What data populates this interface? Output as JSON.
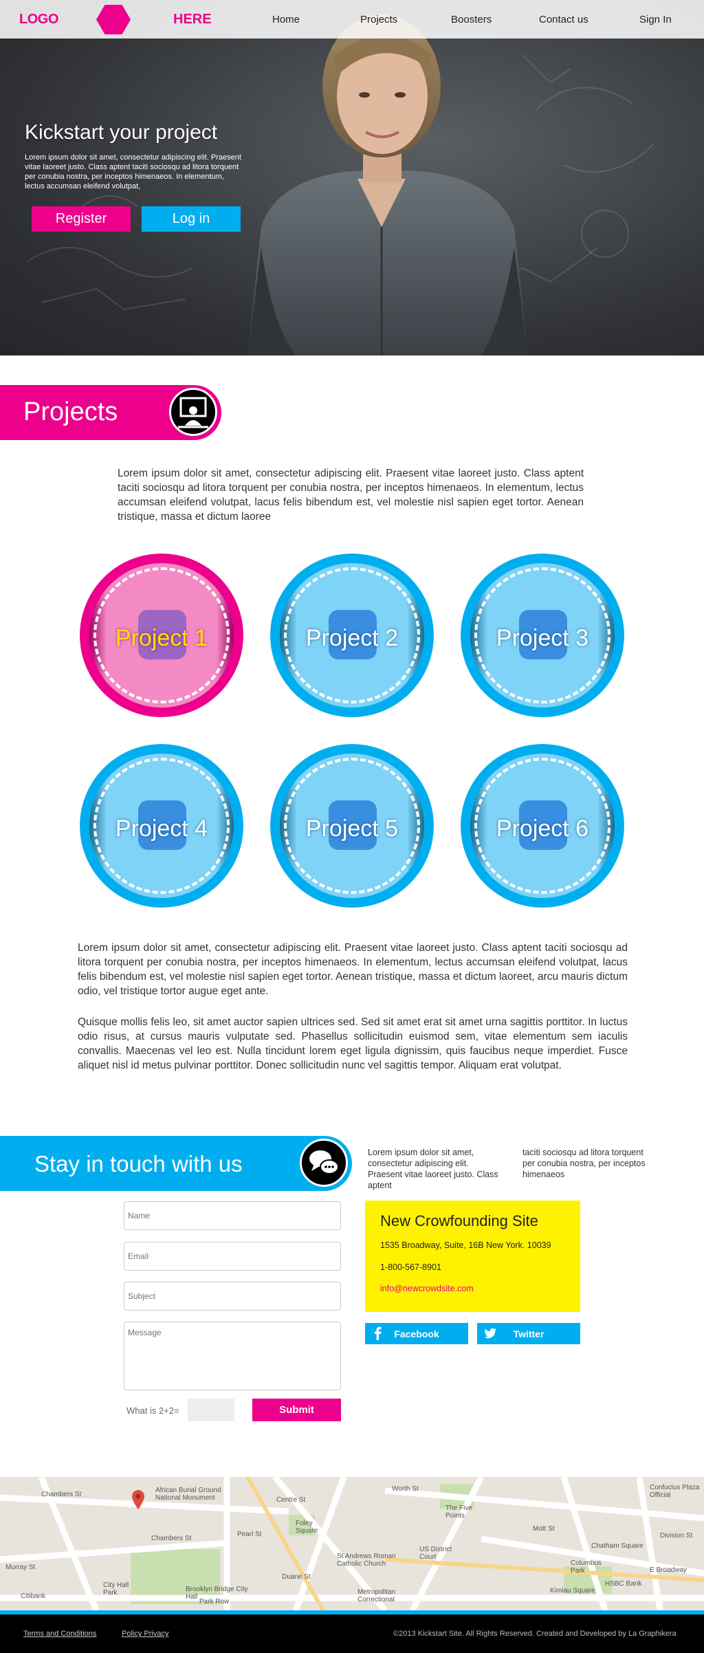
{
  "nav": {
    "logo_left": "LOGO",
    "logo_right": "HERE",
    "items": [
      "Home",
      "Projects",
      "Boosters",
      "Contact us",
      "Sign In"
    ]
  },
  "hero": {
    "title": "Kickstart your project",
    "text": "Lorem ipsum dolor sit amet, consectetur adipiscing elit. Praesent vitae laoreet justo. Class aptent taciti sociosqu ad litora torquent per conubia nostra, per inceptos himenaeos. In elementum, lectus accumsan eleifend volutpat,",
    "register_label": "Register",
    "login_label": "Log in"
  },
  "projects": {
    "title": "Projects",
    "intro": "Lorem ipsum dolor sit amet, consectetur adipiscing elit. Praesent vitae laoreet justo. Class aptent taciti sociosqu ad litora torquent per conubia nostra, per inceptos himenaeos. In elementum, lectus accumsan eleifend volutpat, lacus felis bibendum est, vel molestie nisl sapien eget tortor. Aenean tristique, massa et dictum laoree",
    "items": [
      "Project 1",
      "Project 2",
      "Project 3",
      "Project 4",
      "Project 5",
      "Project 6"
    ],
    "paragraph_1": "Lorem ipsum dolor sit amet, consectetur adipiscing elit. Praesent vitae laoreet justo. Class aptent taciti sociosqu ad litora torquent per conubia nostra, per inceptos himenaeos. In elementum, lectus accumsan eleifend volutpat, lacus felis bibendum est, vel molestie nisl sapien eget tortor. Aenean tristique, massa et dictum laoreet, arcu mauris dictum odio, vel tristique tortor augue eget ante.",
    "paragraph_2": "Quisque mollis felis leo, sit amet auctor sapien ultrices sed. Sed sit amet erat sit amet urna sagittis porttitor. In luctus odio risus, at cursus mauris vulputate sed. Phasellus sollicitudin euismod sem, vitae elementum sem iaculis convallis. Maecenas vel leo est. Nulla tincidunt lorem eget ligula dignissim, quis faucibus neque imperdiet. Fusce aliquet nisl id metus pulvinar porttitor. Donec sollicitudin nunc vel sagittis tempor. Aliquam erat volutpat."
  },
  "contact": {
    "title": "Stay in touch with us",
    "text_col1": "Lorem ipsum dolor sit amet, consectetur adipiscing elit. Praesent vitae laoreet justo. Class aptent",
    "text_col2": "taciti sociosqu ad litora torquent per conubia nostra, per inceptos himenaeos",
    "form": {
      "name_placeholder": "Name",
      "email_placeholder": "Email",
      "subject_placeholder": "Subject",
      "message_placeholder": "Message",
      "captcha_label": "What is 2+2=",
      "submit_label": "Submit"
    },
    "info": {
      "site_name": "New Crowfounding Site",
      "address": "1535 Broadway, Suite, 16B New York. 10039",
      "phone": "1-800-567-8901",
      "email": "info@newcrowdsite.com"
    },
    "social": {
      "facebook_label": "Facebook",
      "twitter_label": "Twitter"
    }
  },
  "map": {
    "labels": [
      "Chambers St",
      "African Burial Ground National Monument",
      "Chambers St",
      "City Hall Park",
      "Brooklyn Bridge City Hall",
      "Pearl St",
      "Foley Square",
      "St Andrews Roman Catholic Church",
      "Metropolitan Correctional",
      "Worth St",
      "The Five Points",
      "US District Court",
      "Mott St",
      "Columbus Park",
      "Confucius Plaza Official",
      "Chatham Square",
      "E Broadway",
      "HSBC Bank",
      "Kimlau Square",
      "Division St",
      "Murray St",
      "Park Row",
      "Centre St",
      "Duane St",
      "Citibank"
    ]
  },
  "footer": {
    "terms": "Terms and Conditions",
    "policy": "Policy Privacy",
    "copyright": "©2013 Kickstart Site. All Rights Reserved. Created and Developed by La Graphikera"
  },
  "colors": {
    "pink": "#ec008c",
    "blue": "#00aeef",
    "yellow": "#fff200"
  },
  "icons": {
    "projects_badge": "presenter-icon",
    "contact_badge": "chat-bubbles-icon",
    "facebook": "facebook-icon",
    "twitter": "twitter-icon",
    "map_marker": "map-marker-icon"
  }
}
